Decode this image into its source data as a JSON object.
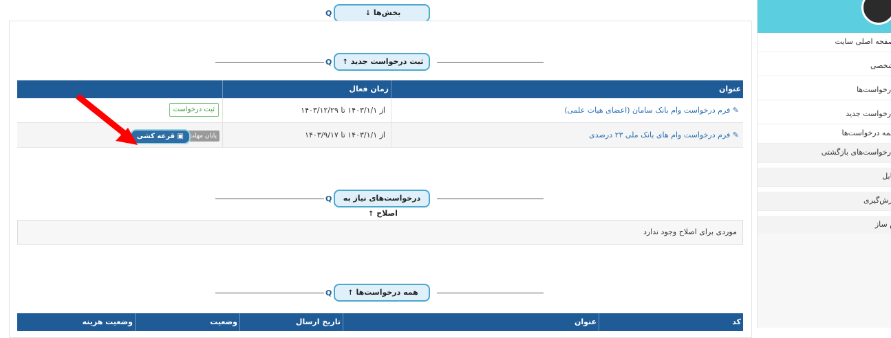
{
  "sidebar": {
    "items": [
      {
        "label": "صفحه اصلی سایت"
      },
      {
        "label": "شخصی"
      },
      {
        "label": "درخواست‌ها"
      },
      {
        "label": "درخواست جدید"
      },
      {
        "label": "همه درخواست‌ها"
      },
      {
        "label": "درخواست‌های بازگشتی"
      },
      {
        "label": "تابل"
      },
      {
        "label": "ارش‌گیری"
      },
      {
        "label": "م ساز"
      }
    ]
  },
  "sections": {
    "parts": {
      "label": "بخش‌ها",
      "arrow": "↓"
    },
    "new_request": {
      "label": "ثبت درخواست جدید",
      "arrow": "↑"
    },
    "needs_fix": {
      "label": "درخواست‌های نیاز به اصلاح",
      "arrow": "↑"
    },
    "all_requests": {
      "label": "همه درخواست‌ها",
      "arrow": "↑"
    }
  },
  "search_glyph": "Q",
  "forms_table": {
    "headers": [
      "عنوان",
      "زمان فعال"
    ],
    "rows": [
      {
        "title": "فرم درخواست وام بانک سامان (اعضای هیات علمی)",
        "period": "از ۱۴۰۳/۱/۱ تا ۱۴۰۳/۱۲/۲۹",
        "register_label": "ثبت درخواست"
      },
      {
        "title": "فرم درخواست وام های بانک ملی ۲۳ درصدی",
        "period": "از ۱۴۰۳/۱/۱ تا ۱۴۰۳/۹/۱۷",
        "lottery_label": "قرعه کشی",
        "deadline_label": "پایان مهلت"
      }
    ]
  },
  "needs_fix_empty": "موردی برای اصلاح وجود ندارد",
  "all_table": {
    "headers": [
      "کد",
      "عنوان",
      "تاریخ ارسال",
      "وضعیت",
      "وضعیت هزینه"
    ]
  },
  "colors": {
    "header_bg": "#1e5b97",
    "sidebar_accent": "#5bcfe0",
    "arrow_annotation": "#ff0000"
  }
}
